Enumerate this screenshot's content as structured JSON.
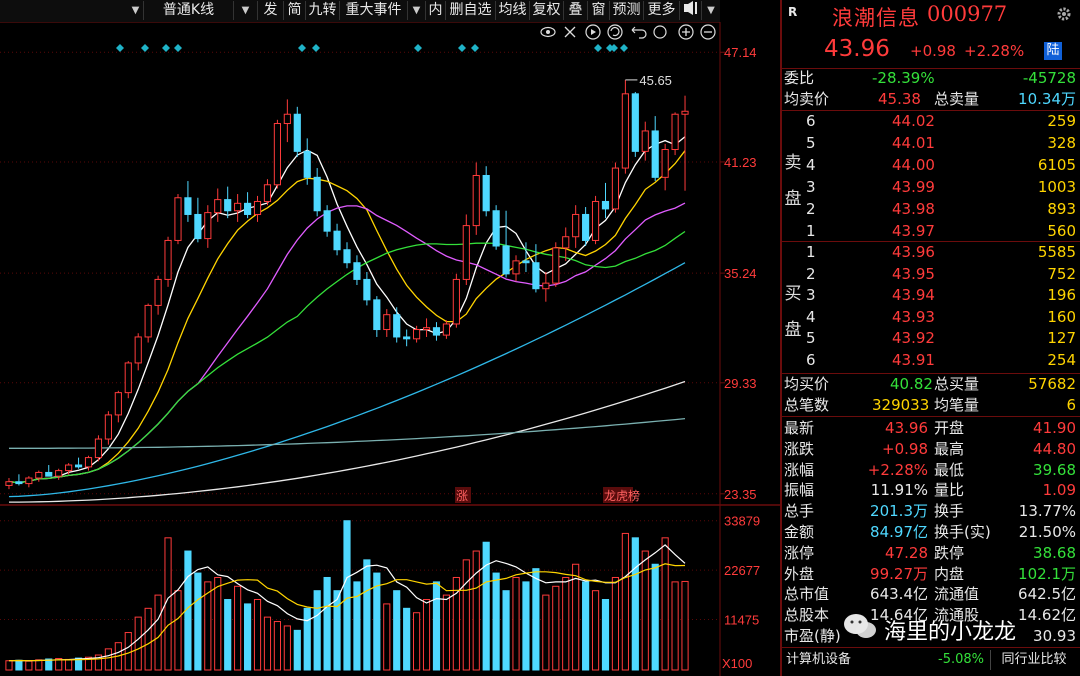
{
  "toolbar": {
    "items": [
      "普通K线",
      "发",
      "简",
      "九转",
      "重大事件",
      "内",
      "删自选",
      "均线",
      "复权",
      "叠",
      "窗",
      "预测",
      "更多"
    ],
    "dropdown_arrow": "▼",
    "pin_icon": "pin-icon"
  },
  "chart_tools": [
    "eye-icon",
    "scissors-icon",
    "play-icon",
    "refresh-icon",
    "undo-icon",
    "zoom-in-icon",
    "zoom-out-icon"
  ],
  "price_axis": [
    "47.14",
    "41.23",
    "35.24",
    "29.33",
    "23.35"
  ],
  "volume_axis": [
    "33879",
    "22677",
    "11475",
    "X100"
  ],
  "annotations": {
    "high_label": "45.65",
    "zhang": "涨",
    "longhu": "龙虎榜"
  },
  "colors": {
    "up": "#ff3b3b",
    "down": "#4fd8ff",
    "bg": "#000000",
    "grid": "#6b0c0c",
    "ma5": "#ffffff",
    "ma10": "#ffd400",
    "ma20": "#e05cff",
    "ma30": "#34e03a",
    "ma60": "#2fb8e8",
    "ma120": "#e8e8e8",
    "ma250": "#7ab0b0"
  },
  "chart_data": {
    "type": "candlestick",
    "ylim": [
      22.8,
      47.8
    ],
    "candles": [
      [
        23.8,
        24.2,
        23.6,
        24.0
      ],
      [
        24.0,
        24.4,
        23.8,
        23.9
      ],
      [
        23.9,
        24.3,
        23.7,
        24.2
      ],
      [
        24.2,
        24.6,
        24.0,
        24.5
      ],
      [
        24.5,
        24.9,
        24.3,
        24.3
      ],
      [
        24.3,
        24.7,
        24.1,
        24.6
      ],
      [
        24.6,
        25.0,
        24.4,
        24.9
      ],
      [
        24.9,
        25.3,
        24.7,
        24.8
      ],
      [
        24.8,
        25.4,
        24.6,
        25.3
      ],
      [
        25.3,
        26.5,
        25.1,
        26.3
      ],
      [
        26.3,
        27.8,
        26.0,
        27.6
      ],
      [
        27.6,
        28.9,
        27.2,
        28.8
      ],
      [
        28.8,
        30.5,
        28.5,
        30.4
      ],
      [
        30.4,
        32.0,
        30.0,
        31.8
      ],
      [
        31.8,
        33.6,
        31.5,
        33.5
      ],
      [
        33.5,
        35.1,
        33.0,
        34.9
      ],
      [
        34.9,
        37.2,
        34.5,
        37.0
      ],
      [
        37.0,
        39.5,
        36.8,
        39.3
      ],
      [
        39.3,
        40.2,
        38.0,
        38.4
      ],
      [
        38.4,
        39.3,
        36.9,
        37.1
      ],
      [
        37.1,
        38.9,
        36.6,
        38.5
      ],
      [
        38.5,
        39.8,
        38.0,
        39.2
      ],
      [
        39.2,
        39.9,
        38.2,
        38.6
      ],
      [
        38.6,
        39.5,
        38.0,
        39.0
      ],
      [
        39.0,
        39.6,
        38.2,
        38.4
      ],
      [
        38.4,
        39.4,
        38.0,
        39.1
      ],
      [
        39.1,
        40.3,
        38.9,
        40.0
      ],
      [
        40.0,
        43.5,
        39.8,
        43.3
      ],
      [
        43.3,
        44.6,
        42.3,
        43.8
      ],
      [
        43.8,
        44.2,
        41.5,
        41.8
      ],
      [
        41.8,
        42.5,
        40.0,
        40.4
      ],
      [
        40.4,
        40.9,
        38.3,
        38.6
      ],
      [
        38.6,
        38.9,
        37.2,
        37.5
      ],
      [
        37.5,
        37.9,
        36.2,
        36.5
      ],
      [
        36.5,
        36.9,
        35.5,
        35.8
      ],
      [
        35.8,
        36.2,
        34.6,
        34.9
      ],
      [
        34.9,
        35.3,
        33.5,
        33.8
      ],
      [
        33.8,
        34.0,
        31.8,
        32.2
      ],
      [
        32.2,
        33.3,
        31.8,
        33.0
      ],
      [
        33.0,
        33.4,
        31.5,
        31.8
      ],
      [
        31.8,
        32.2,
        31.3,
        31.7
      ],
      [
        31.7,
        32.4,
        31.5,
        32.2
      ],
      [
        32.2,
        32.8,
        31.8,
        32.3
      ],
      [
        32.3,
        32.6,
        31.6,
        31.9
      ],
      [
        31.9,
        32.7,
        31.7,
        32.5
      ],
      [
        32.5,
        35.2,
        32.3,
        34.9
      ],
      [
        34.9,
        38.4,
        34.6,
        37.8
      ],
      [
        37.8,
        41.2,
        37.3,
        40.5
      ],
      [
        40.5,
        41.0,
        38.3,
        38.6
      ],
      [
        38.6,
        38.9,
        36.5,
        36.7
      ],
      [
        36.7,
        38.6,
        35.0,
        35.2
      ],
      [
        35.2,
        36.2,
        34.8,
        35.9
      ],
      [
        35.9,
        36.9,
        35.3,
        35.8
      ],
      [
        35.8,
        36.8,
        34.2,
        34.4
      ],
      [
        34.4,
        35.3,
        33.7,
        34.7
      ],
      [
        34.7,
        36.9,
        34.5,
        36.6
      ],
      [
        36.6,
        37.7,
        35.9,
        37.2
      ],
      [
        37.2,
        38.9,
        36.6,
        38.4
      ],
      [
        38.4,
        38.8,
        36.7,
        37.0
      ],
      [
        37.0,
        39.4,
        36.8,
        39.1
      ],
      [
        39.1,
        40.1,
        38.2,
        38.7
      ],
      [
        38.7,
        41.2,
        38.5,
        40.9
      ],
      [
        40.9,
        45.65,
        40.6,
        44.9
      ],
      [
        44.9,
        45.0,
        41.5,
        41.8
      ],
      [
        41.8,
        43.4,
        41.3,
        42.9
      ],
      [
        42.9,
        43.7,
        40.2,
        40.4
      ],
      [
        40.4,
        42.2,
        39.7,
        41.9
      ],
      [
        41.9,
        43.9,
        41.6,
        43.8
      ],
      [
        43.8,
        44.8,
        39.68,
        43.96
      ]
    ],
    "volumes": [
      2100,
      2200,
      2000,
      2300,
      2500,
      2600,
      2400,
      2700,
      2900,
      3400,
      4800,
      6200,
      8500,
      12000,
      14000,
      17000,
      30000,
      18000,
      27000,
      22000,
      20000,
      21000,
      16000,
      19000,
      15000,
      16000,
      12000,
      11000,
      10000,
      9000,
      14000,
      18000,
      21000,
      18000,
      33879,
      20000,
      25000,
      22000,
      15000,
      18000,
      14000,
      13000,
      16000,
      20000,
      17000,
      21000,
      25000,
      27000,
      29000,
      22000,
      18000,
      21000,
      20000,
      23000,
      17000,
      19000,
      21000,
      24000,
      20000,
      18000,
      16000,
      21000,
      31000,
      30000,
      27000,
      24000,
      30000,
      20000,
      20100
    ]
  },
  "stock": {
    "marker": "R",
    "name": "浪潮信息",
    "code": "000977",
    "price": "43.96",
    "change": "+0.98",
    "change_pct": "+2.28%",
    "badge": "陆"
  },
  "weibi": {
    "label": "委比",
    "pct": "-28.39%",
    "diff": "-45728"
  },
  "avg_sell": {
    "label": "均卖价",
    "value": "45.38",
    "total_label": "总卖量",
    "total": "10.34万"
  },
  "sell_side": {
    "label": "卖盘",
    "rows": [
      {
        "lvl": "6",
        "price": "44.02",
        "vol": "259"
      },
      {
        "lvl": "5",
        "price": "44.01",
        "vol": "328"
      },
      {
        "lvl": "4",
        "price": "44.00",
        "vol": "6105"
      },
      {
        "lvl": "3",
        "price": "43.99",
        "vol": "1003"
      },
      {
        "lvl": "2",
        "price": "43.98",
        "vol": "893"
      },
      {
        "lvl": "1",
        "price": "43.97",
        "vol": "560"
      }
    ]
  },
  "buy_side": {
    "label": "买盘",
    "rows": [
      {
        "lvl": "1",
        "price": "43.96",
        "vol": "5585"
      },
      {
        "lvl": "2",
        "price": "43.95",
        "vol": "752"
      },
      {
        "lvl": "3",
        "price": "43.94",
        "vol": "196"
      },
      {
        "lvl": "4",
        "price": "43.93",
        "vol": "160"
      },
      {
        "lvl": "5",
        "price": "43.92",
        "vol": "127"
      },
      {
        "lvl": "6",
        "price": "43.91",
        "vol": "254"
      }
    ]
  },
  "avg_buy": {
    "label": "均买价",
    "value": "40.82",
    "total_label": "总买量",
    "total": "57682"
  },
  "trades": {
    "label": "总笔数",
    "value": "329033",
    "avg_label": "均笔量",
    "avg": "6"
  },
  "stats": [
    {
      "l1": "最新",
      "v1": "43.96",
      "c1": "red",
      "l2": "开盘",
      "v2": "41.90",
      "c2": "red"
    },
    {
      "l1": "涨跌",
      "v1": "+0.98",
      "c1": "red",
      "l2": "最高",
      "v2": "44.80",
      "c2": "red"
    },
    {
      "l1": "涨幅",
      "v1": "+2.28%",
      "c1": "red",
      "l2": "最低",
      "v2": "39.68",
      "c2": "green"
    },
    {
      "l1": "振幅",
      "v1": "11.91%",
      "c1": "white",
      "l2": "量比",
      "v2": "1.09",
      "c2": "red"
    },
    {
      "l1": "总手",
      "v1": "201.3万",
      "c1": "cyan",
      "l2": "换手",
      "v2": "13.77%",
      "c2": "white"
    },
    {
      "l1": "金额",
      "v1": "84.97亿",
      "c1": "cyan",
      "l2": "换手(实)",
      "v2": "21.50%",
      "c2": "white"
    },
    {
      "l1": "涨停",
      "v1": "47.28",
      "c1": "red",
      "l2": "跌停",
      "v2": "38.68",
      "c2": "green"
    },
    {
      "l1": "外盘",
      "v1": "99.27万",
      "c1": "red",
      "l2": "内盘",
      "v2": "102.1万",
      "c2": "green"
    },
    {
      "l1": "总市值",
      "v1": "643.4亿",
      "c1": "white",
      "l2": "流通值",
      "v2": "642.5亿",
      "c2": "white"
    },
    {
      "l1": "总股本",
      "v1": "14.64亿",
      "c1": "white",
      "l2": "流通股",
      "v2": "14.62亿",
      "c2": "white"
    },
    {
      "l1": "市盈(静)",
      "v1": "",
      "c1": "white",
      "l2": "",
      "v2": "30.93",
      "c2": "white"
    }
  ],
  "footer": {
    "industry": "计算机设备",
    "industry_pct": "-5.08%",
    "compare": "同行业比较"
  },
  "watermark": "海里的小龙龙"
}
